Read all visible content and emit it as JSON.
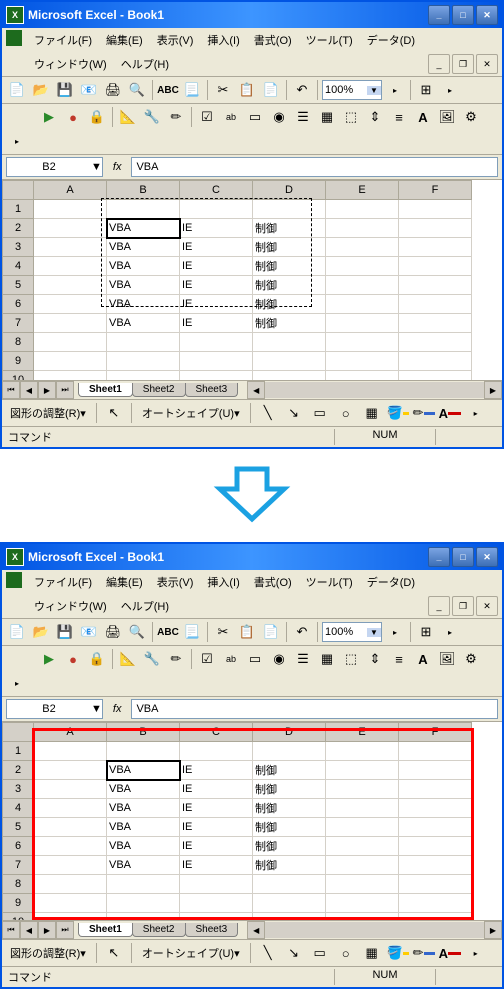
{
  "title": "Microsoft Excel - Book1",
  "menus": {
    "file": "ファイル(F)",
    "edit": "編集(E)",
    "view": "表示(V)",
    "insert": "挿入(I)",
    "format": "書式(O)",
    "tools": "ツール(T)",
    "data": "データ(D)",
    "window": "ウィンドウ(W)",
    "help": "ヘルプ(H)"
  },
  "zoom": "100%",
  "nameBox": "B2",
  "formulaValue": "VBA",
  "columns": [
    "A",
    "B",
    "C",
    "D",
    "E",
    "F"
  ],
  "rows": [
    "1",
    "2",
    "3",
    "4",
    "5",
    "6",
    "7",
    "8",
    "9",
    "10"
  ],
  "cells": {
    "b": "VBA",
    "c": "IE",
    "d": "制御"
  },
  "dataRows": [
    2,
    3,
    4,
    5,
    6,
    7
  ],
  "sheets": [
    "Sheet1",
    "Sheet2",
    "Sheet3"
  ],
  "activeSheet": "Sheet1",
  "drawMenu": "図形の調整(R)",
  "autoShape": "オートシェイプ(U)",
  "statusLeft": "コマンド",
  "statusRight": "NUM",
  "excelIcon": "X"
}
